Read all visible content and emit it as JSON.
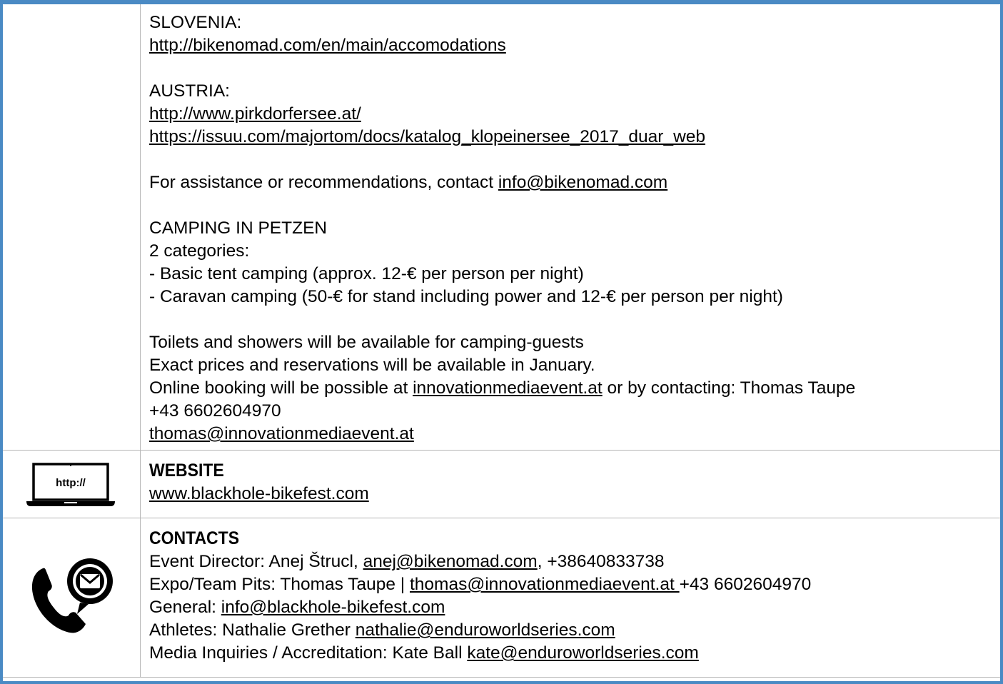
{
  "accommodation": {
    "slovenia_label": "SLOVENIA:",
    "slovenia_link": "http://bikenomad.com/en/main/accomodations",
    "austria_label": "AUSTRIA:",
    "austria_link1": "http://www.pirkdorfersee.at/",
    "austria_link2": "https://issuu.com/majortom/docs/katalog_klopeinersee_2017_duar_web",
    "assist_text": "For assistance or recommendations, contact ",
    "assist_email": "info@bikenomad.com",
    "camping_title": "CAMPING IN PETZEN",
    "camping_categories": "2 categories:",
    "camping_basic": "- Basic tent camping (approx. 12-€ per person per night)",
    "camping_caravan": "- Caravan camping (50-€ for stand including power and 12-€ per person per night)",
    "toilets": "Toilets and showers will be available for camping-guests",
    "prices": "Exact prices and reservations will be available in January.",
    "booking_prefix": "Online booking will be possible at ",
    "booking_link": "innovationmediaevent.at",
    "booking_suffix": " or by contacting: Thomas Taupe",
    "booking_phone": "+43 6602604970",
    "booking_email": "thomas@innovationmediaevent.at"
  },
  "website": {
    "icon_label": "http://",
    "heading": "WEBSITE",
    "url": "www.blackhole-bikefest.com"
  },
  "contacts": {
    "heading": "CONTACTS",
    "director_prefix": "Event Director: Anej Štrucl, ",
    "director_email": "anej@bikenomad.com",
    "director_suffix": ", +38640833738",
    "expo_prefix": "Expo/Team Pits: Thomas Taupe | ",
    "expo_email": "thomas@innovationmediaevent.at ",
    "expo_suffix": "+43 6602604970",
    "general_prefix": "General: ",
    "general_email": "info@blackhole-bikefest.com",
    "athletes_prefix": "Athletes: Nathalie Grether ",
    "athletes_email": "nathalie@enduroworldseries.com",
    "media_prefix": "Media Inquiries / Accreditation: Kate Ball ",
    "media_email": "kate@enduroworldseries.com"
  },
  "colors": {
    "frame": "#4a8ac4",
    "grid": "#b5b5b5"
  }
}
